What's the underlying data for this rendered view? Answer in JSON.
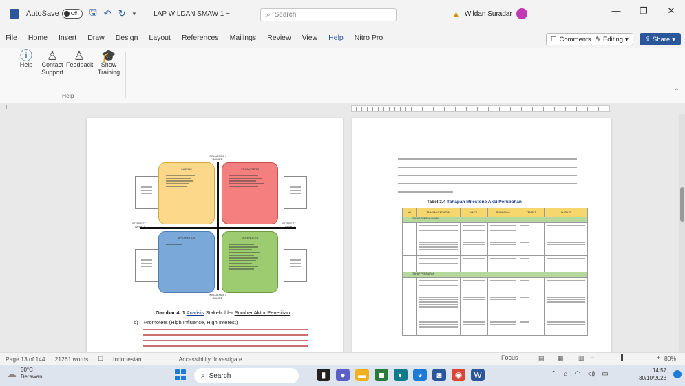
{
  "titlebar": {
    "autosave_label": "AutoSave",
    "autosave_state": "Off",
    "doc_title": "LAP WILDAN SMAW 1 ~",
    "search_placeholder": "Search",
    "user_name": "Wildan Suradar"
  },
  "menubar": {
    "items": [
      "File",
      "Home",
      "Insert",
      "Draw",
      "Design",
      "Layout",
      "References",
      "Mailings",
      "Review",
      "View",
      "Help",
      "Nitro Pro"
    ],
    "active_index": 10,
    "comments_label": "Comments",
    "editing_label": "Editing",
    "share_label": "Share"
  },
  "ribbon": {
    "buttons": [
      {
        "label": "Help",
        "icon": "help-circle-icon"
      },
      {
        "label": "Contact Support",
        "icon": "contact-person-icon"
      },
      {
        "label": "Feedback",
        "icon": "feedback-person-icon"
      },
      {
        "label": "Show Training",
        "icon": "graduation-cap-icon"
      }
    ],
    "group_label": "Help"
  },
  "document": {
    "left_page": {
      "figure_caption_prefix": "Gambar 4. 1",
      "figure_caption_link": "Analisis",
      "figure_caption_mid": "Stakeholder",
      "figure_caption_link2": "Sumber Aktor Penelitian",
      "bullet_letter": "b)",
      "bullet_text": "Promoters (High Influence, High Interest)",
      "quadrants": [
        "LATENS",
        "PROMOTERS",
        "APATHETICS",
        "DEFENDERS"
      ],
      "axis_top": "INFLUENCE / POWER",
      "axis_bottom": "INFLUENCE / POWER",
      "axis_left": "INTEREST / IMPACT",
      "axis_right": "INTEREST / IMPACT"
    },
    "right_page": {
      "table_title_prefix": "Tabel 3.4",
      "table_title_link": "Tahapan Milestone Aksi Perubahan",
      "table_headers": [
        "NO",
        "TAHAPAN KEGIATAN",
        "WAKTU",
        "PELAKSANA",
        "TEMPAT",
        "OUTPUT"
      ],
      "section_1": "TAHAP PERENCANAAN",
      "section_2": "TAHAP PERSIAPAN"
    }
  },
  "statusbar": {
    "page": "Page 13 of 144",
    "words": "21261 words",
    "language": "Indonesian",
    "accessibility": "Accessibility: Investigate",
    "focus": "Focus",
    "zoom": "80%"
  },
  "taskbar": {
    "weather_temp": "30°C",
    "weather_desc": "Berawan",
    "search_label": "Search",
    "time": "14:57",
    "date": "30/10/2023"
  }
}
